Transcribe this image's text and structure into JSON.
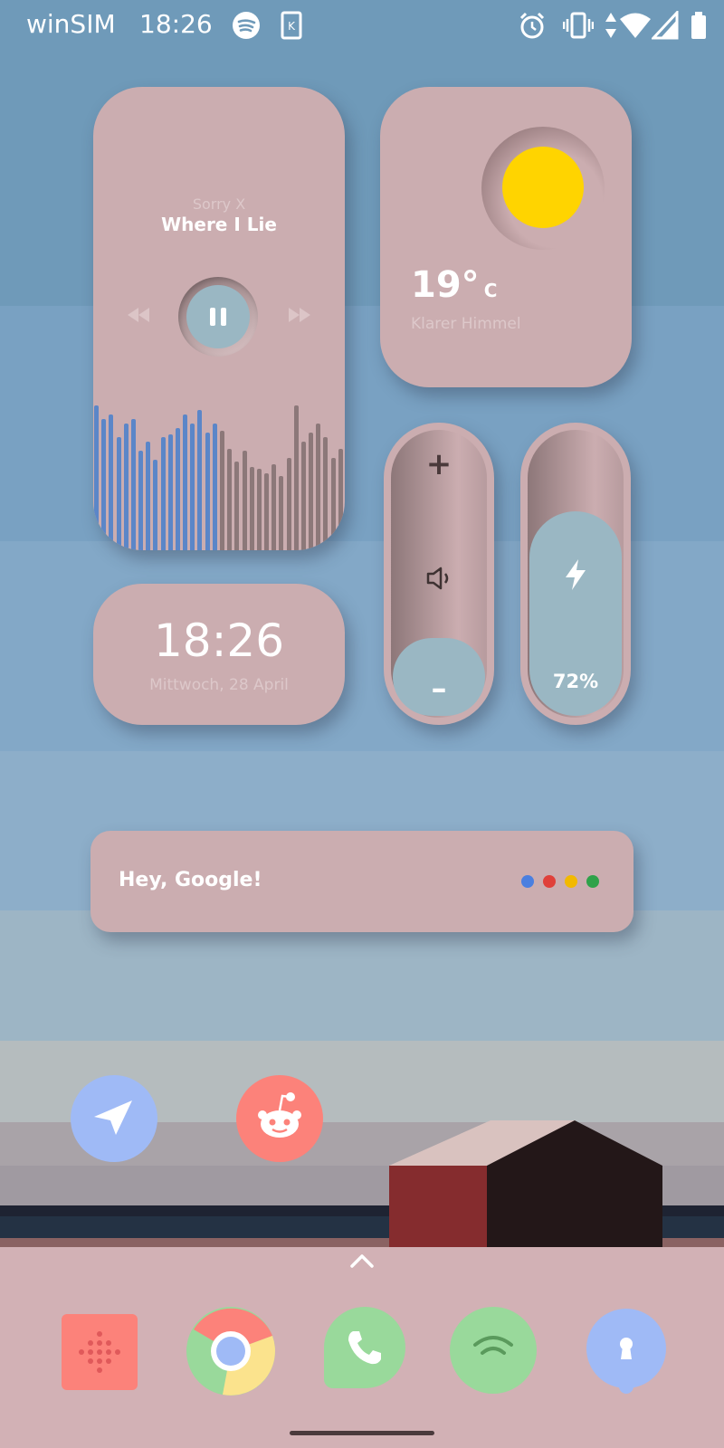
{
  "status_bar": {
    "carrier": "winSIM",
    "time": "18:26"
  },
  "music": {
    "artist": "Sorry X",
    "title": "Where I Lie",
    "progress": 0.5
  },
  "weather": {
    "temperature": "19°",
    "unit": "C",
    "condition": "Klarer Himmel"
  },
  "clock": {
    "time": "18:26",
    "date": "Mittwoch, 28 April"
  },
  "volume": {
    "plus": "+",
    "minus": "–",
    "level": 0.25
  },
  "battery": {
    "percent": "72%",
    "level": 0.72
  },
  "assistant": {
    "prompt": "Hey, Google!"
  },
  "colors": {
    "card": "#cbadb0",
    "accent_blue": "#9ab7c3",
    "sun": "#ffd400",
    "eq_blue": "#5b86c8",
    "eq_grey": "#8c7879"
  }
}
